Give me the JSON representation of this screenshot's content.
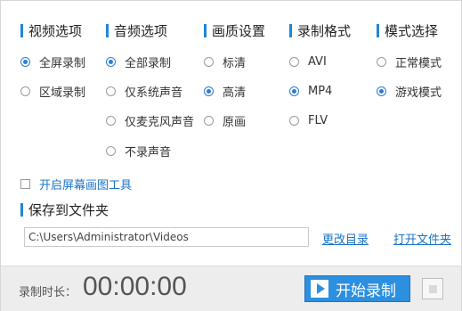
{
  "sections": {
    "video": {
      "title": "视频选项",
      "options": [
        {
          "label": "全屏录制",
          "selected": true
        },
        {
          "label": "区域录制",
          "selected": false
        }
      ]
    },
    "audio": {
      "title": "音频选项",
      "options": [
        {
          "label": "全部录制",
          "selected": true
        },
        {
          "label": "仅系统声音",
          "selected": false
        },
        {
          "label": "仅麦克风声音",
          "selected": false
        },
        {
          "label": "不录声音",
          "selected": false
        }
      ]
    },
    "quality": {
      "title": "画质设置",
      "options": [
        {
          "label": "标清",
          "selected": false
        },
        {
          "label": "高清",
          "selected": true
        },
        {
          "label": "原画",
          "selected": false
        }
      ]
    },
    "format": {
      "title": "录制格式",
      "options": [
        {
          "label": "AVI",
          "selected": false
        },
        {
          "label": "MP4",
          "selected": true
        },
        {
          "label": "FLV",
          "selected": false
        }
      ]
    },
    "mode": {
      "title": "模式选择",
      "options": [
        {
          "label": "正常模式",
          "selected": false
        },
        {
          "label": "游戏模式",
          "selected": true
        }
      ]
    }
  },
  "drawing_tool": {
    "label": "开启屏幕画图工具",
    "checked": false
  },
  "save": {
    "title": "保存到文件夹",
    "path": "C:\\Users\\Administrator\\Videos",
    "change_dir_label": "更改目录",
    "open_folder_label": "打开文件夹"
  },
  "footer": {
    "duration_label": "录制时长：",
    "timer": "00:00:00",
    "start_label": "开始录制"
  },
  "colors": {
    "accent": "#2c8fe0",
    "link": "#1a73c8"
  }
}
